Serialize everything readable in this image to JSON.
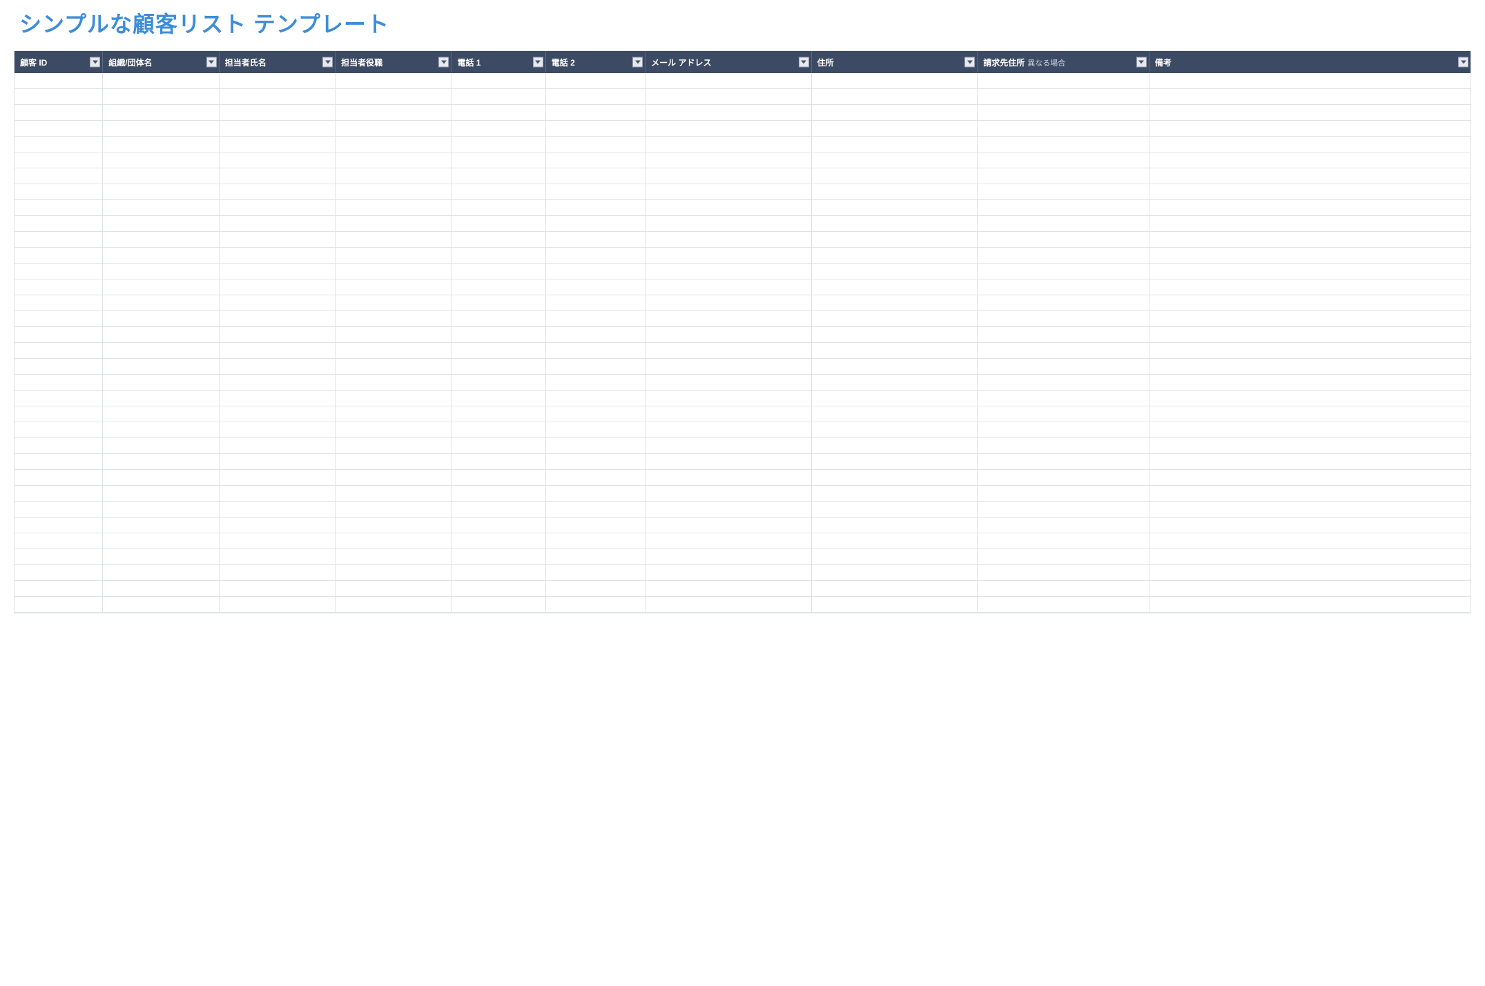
{
  "title": "シンプルな顧客リスト テンプレート",
  "columns": [
    {
      "label": "顧客 ID",
      "sub": ""
    },
    {
      "label": "組織/団体名",
      "sub": ""
    },
    {
      "label": "担当者氏名",
      "sub": ""
    },
    {
      "label": "担当者役職",
      "sub": ""
    },
    {
      "label": "電話 1",
      "sub": ""
    },
    {
      "label": "電話 2",
      "sub": ""
    },
    {
      "label": "メール アドレス",
      "sub": ""
    },
    {
      "label": "住所",
      "sub": ""
    },
    {
      "label": "請求先住所",
      "sub": "異なる場合"
    },
    {
      "label": "備考",
      "sub": ""
    }
  ],
  "row_count": 34,
  "shaded_columns": [
    0,
    1,
    2,
    3
  ]
}
